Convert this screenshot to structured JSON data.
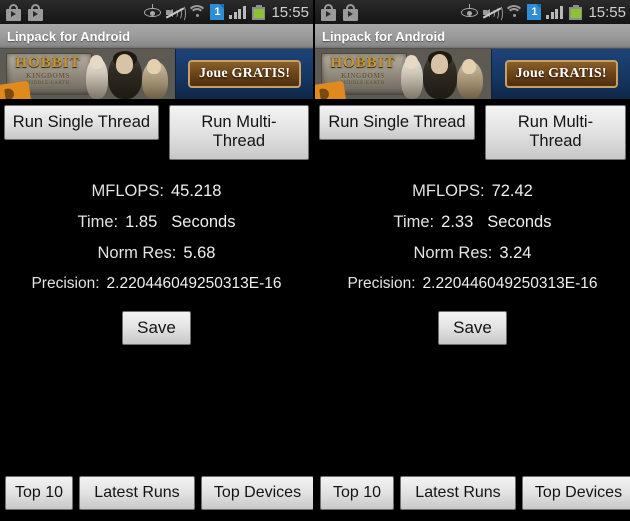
{
  "status_bar": {
    "left_icons": [
      "play-store-bag-icon",
      "play-store-bag-icon"
    ],
    "right_icons": [
      "eye-icon",
      "volume-muted-icon",
      "wifi-icon",
      "document-badge-icon",
      "signal-bars-icon",
      "battery-icon"
    ],
    "badge_count": "1",
    "clock": "15:55",
    "battery_color": "#8bc431",
    "badge_color": "#2e8fd6"
  },
  "app": {
    "title": "Linpack for Android"
  },
  "banner": {
    "logo_line1": "HOBBIT",
    "logo_line2": "KINGDOMS",
    "logo_line3": "MIDDLE-EARTH",
    "cta_label": "Joue GRATIS!",
    "cta_border_color": "#c6a163",
    "background_color": "#1b3b6e"
  },
  "buttons": {
    "run_single": "Run Single Thread",
    "run_multi": "Run Multi-\nThread",
    "run_multi_line1": "Run Multi-",
    "run_multi_line2": "Thread",
    "save": "Save"
  },
  "bottom_bar": {
    "top10": "Top 10",
    "latest_runs": "Latest Runs",
    "top_devices": "Top Devices"
  },
  "labels": {
    "mflops": "MFLOPS:",
    "time": "Time:",
    "norm_res": "Norm Res:",
    "precision": "Precision:",
    "seconds_unit": "Seconds"
  },
  "panels": {
    "left": {
      "mflops": "45.218",
      "time": "1.85",
      "norm_res": "5.68",
      "precision": "2.220446049250313E-16"
    },
    "right": {
      "mflops": "72.42",
      "time": "2.33",
      "norm_res": "3.24",
      "precision": "2.220446049250313E-16"
    }
  }
}
